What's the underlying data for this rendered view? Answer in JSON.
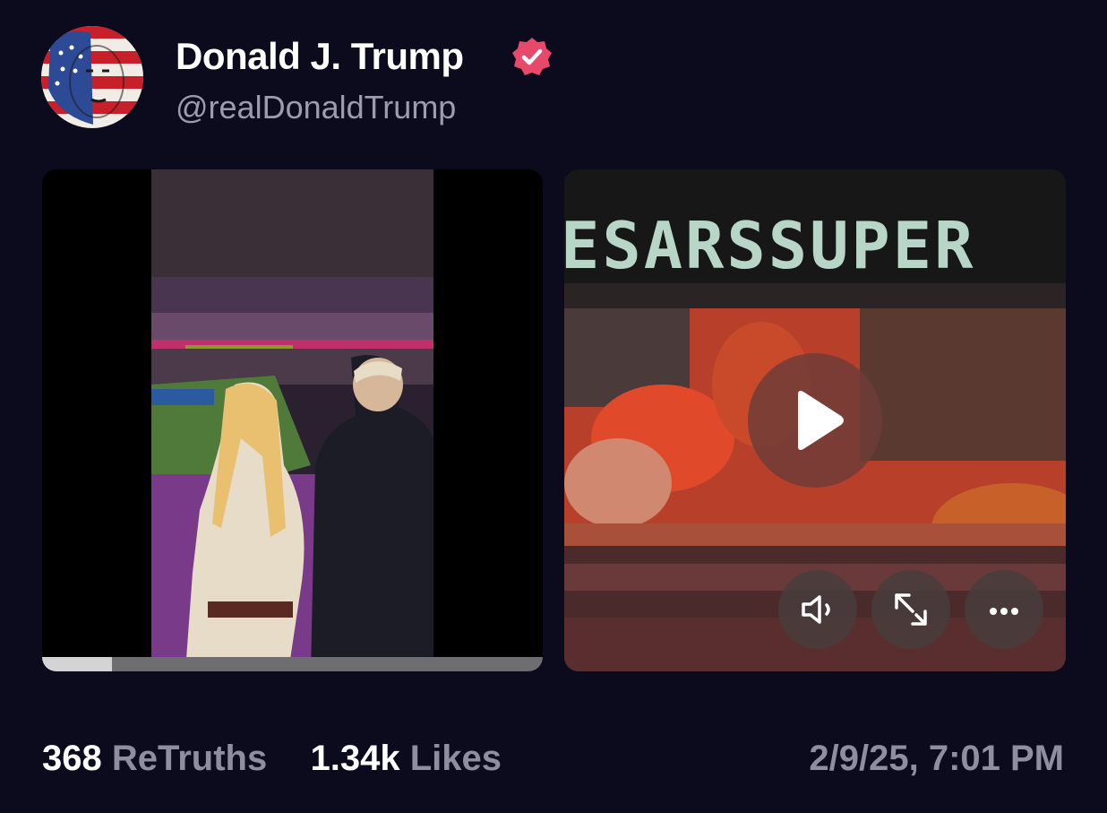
{
  "post": {
    "author": {
      "display_name": "Donald J. Trump",
      "handle": "@realDonaldTrump",
      "verified": true,
      "verified_badge_color": "#e8486a"
    },
    "media": [
      {
        "kind": "video",
        "progress_fraction": 0.14,
        "description_icon": "video-thumbnail"
      },
      {
        "kind": "video",
        "scoreboard_text": "ESARSSUPER",
        "controls": {
          "play_icon": "play-icon",
          "mute_icon": "speaker-icon",
          "expand_icon": "expand-icon",
          "more_icon": "more-icon"
        }
      }
    ],
    "stats": {
      "retruths_count": "368",
      "retruths_label": "ReTruths",
      "likes_count": "1.34k",
      "likes_label": "Likes"
    },
    "timestamp": "2/9/25, 7:01 PM"
  }
}
